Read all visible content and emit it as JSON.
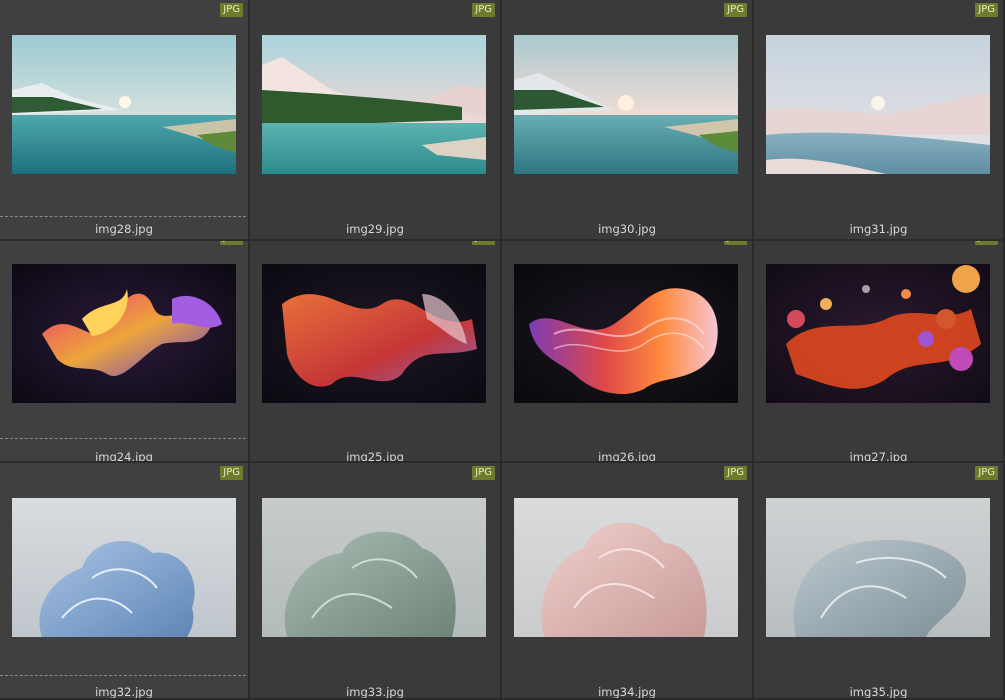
{
  "badge_label": "JPG",
  "thumbnails": [
    {
      "filename": "img28.jpg",
      "kind": "lake"
    },
    {
      "filename": "img29.jpg",
      "kind": "lake2"
    },
    {
      "filename": "img30.jpg",
      "kind": "lake3"
    },
    {
      "filename": "img31.jpg",
      "kind": "lake4"
    },
    {
      "filename": "img24.jpg",
      "kind": "ribbon1"
    },
    {
      "filename": "img25.jpg",
      "kind": "ribbon2"
    },
    {
      "filename": "img26.jpg",
      "kind": "ribbon3"
    },
    {
      "filename": "img27.jpg",
      "kind": "bubbles"
    },
    {
      "filename": "img32.jpg",
      "kind": "bloom-blue"
    },
    {
      "filename": "img33.jpg",
      "kind": "bloom-sage"
    },
    {
      "filename": "img34.jpg",
      "kind": "bloom-pink"
    },
    {
      "filename": "img35.jpg",
      "kind": "bloom-grey"
    }
  ],
  "colors": {
    "badge": "#6f7a2c",
    "background": "#3a3a3a",
    "text": "#d8d8d8"
  }
}
